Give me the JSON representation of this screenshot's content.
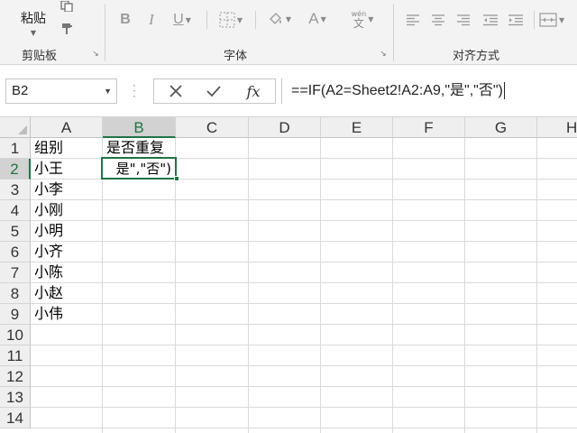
{
  "ribbon": {
    "clipboard": {
      "paste_label": "粘贴",
      "group_label": "剪贴板"
    },
    "font": {
      "group_label": "字体",
      "bold": "B",
      "italic": "I",
      "underline": "U",
      "font_color_glyph": "A",
      "phonetic_top": "wén",
      "phonetic_bottom": "文"
    },
    "alignment": {
      "group_label": "对齐方式"
    }
  },
  "formula_bar": {
    "name_box": "B2",
    "fx_label": "fx",
    "formula": "==IF(A2=Sheet2!A2:A9,\"是\",\"否\")"
  },
  "sheet": {
    "columns": [
      "A",
      "B",
      "C",
      "D",
      "E",
      "F",
      "G",
      "H"
    ],
    "rows": [
      "1",
      "2",
      "3",
      "4",
      "5",
      "6",
      "7",
      "8",
      "9",
      "10",
      "11",
      "12",
      "13",
      "14"
    ],
    "selected_column": "B",
    "selected_row": "2",
    "cells": {
      "A1": "组别",
      "B1": "是否重复",
      "A2": "小王",
      "A3": "小李",
      "A4": "小刚",
      "A5": "小明",
      "A6": "小齐",
      "A7": "小陈",
      "A8": "小赵",
      "A9": "小伟"
    },
    "active_cell": {
      "ref": "B2",
      "edit_text": "是\",\"否\")"
    }
  },
  "colors": {
    "accent": "#217346",
    "ribbon_bg": "#f3f3f3",
    "header_bg": "#efefef",
    "header_selected_bg": "#d2d2d2"
  }
}
